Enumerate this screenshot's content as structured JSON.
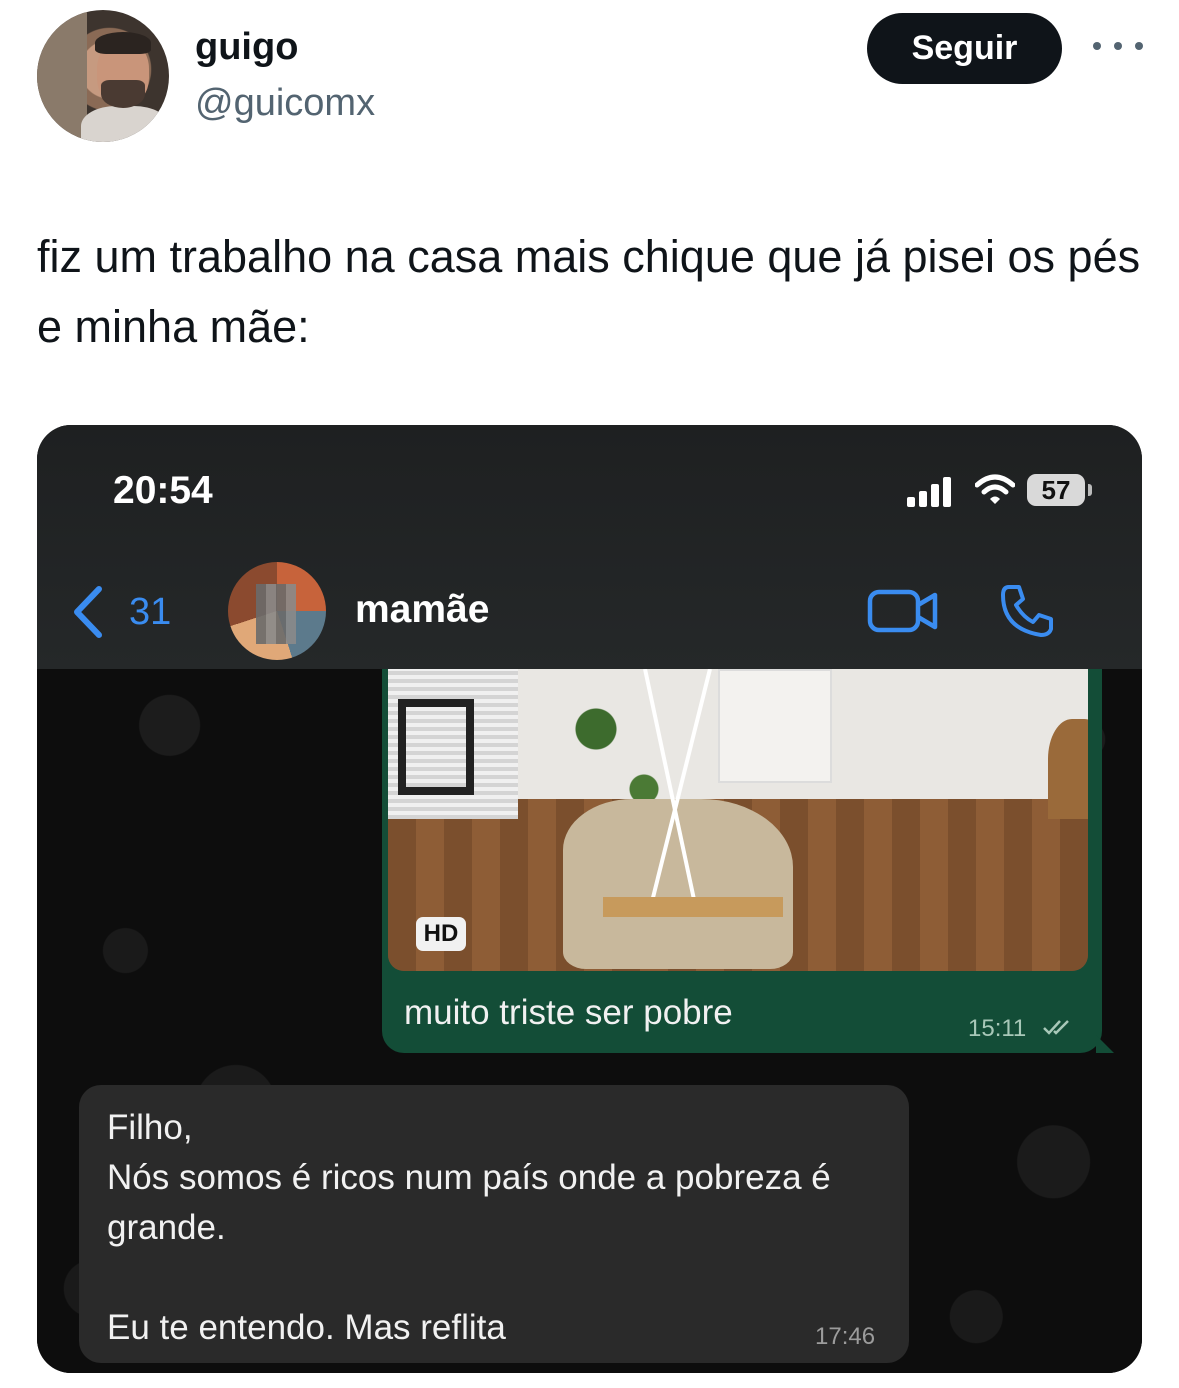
{
  "tweet": {
    "display_name": "guigo",
    "handle": "@guicomx",
    "follow_label": "Seguir",
    "text": "fiz um trabalho na casa mais chique que já pisei os pés e minha mãe:"
  },
  "screenshot": {
    "status_bar": {
      "time": "20:54",
      "battery": "57"
    },
    "header": {
      "back_count": "31",
      "contact_name": "mamãe"
    },
    "sent_message": {
      "badge": "HD",
      "caption": "muito triste ser pobre",
      "time": "15:11"
    },
    "received_message": {
      "text": "Filho,\nNós somos é ricos num país onde a pobreza é grande.\n\nEu te entendo.  Mas reflita",
      "time": "17:46"
    },
    "colors": {
      "sent_bubble": "#134d37",
      "received_bubble": "#2a2a2a",
      "ios_blue": "#3a8cf0"
    }
  }
}
